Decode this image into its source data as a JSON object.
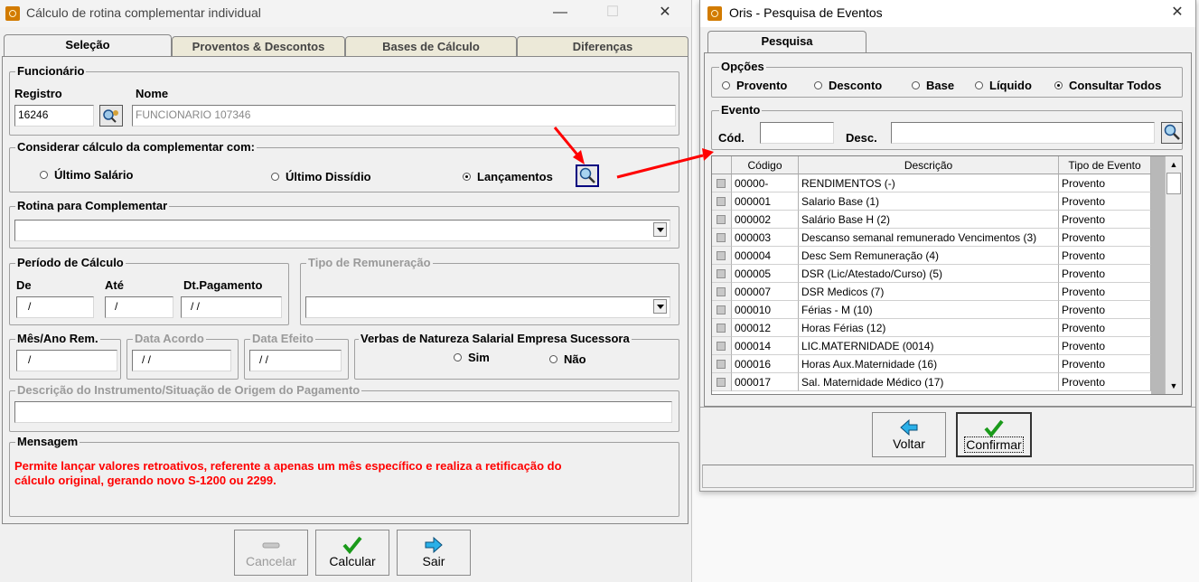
{
  "left": {
    "title": "Cálculo de rotina complementar individual",
    "tabs": [
      "Seleção",
      "Proventos & Descontos",
      "Bases de Cálculo",
      "Diferenças"
    ],
    "funcionario": {
      "legend": "Funcionário",
      "registro_label": "Registro",
      "registro_value": "16246",
      "nome_label": "Nome",
      "nome_value": "FUNCIONARIO 107346"
    },
    "considerar": {
      "legend": "Considerar cálculo da complementar com:",
      "opt1": "Último Salário",
      "opt2": "Último Dissídio",
      "opt3": "Lançamentos"
    },
    "rotina": {
      "legend": "Rotina para Complementar",
      "value": ""
    },
    "periodo": {
      "legend": "Período de Cálculo",
      "de_label": "De",
      "de_value": "/",
      "ate_label": "Até",
      "ate_value": "/",
      "dtpag_label": "Dt.Pagamento",
      "dtpag_value": "/ /"
    },
    "tipo_remuneracao": {
      "legend": "Tipo de Remuneração",
      "value": ""
    },
    "mes_ano": {
      "legend": "Mês/Ano Rem.",
      "value": "/"
    },
    "data_acordo": {
      "legend": "Data Acordo",
      "value": "/ /"
    },
    "data_efeito": {
      "legend": "Data Efeito",
      "value": "/ /"
    },
    "verbas": {
      "legend": "Verbas de Natureza Salarial Empresa Sucessora",
      "sim": "Sim",
      "nao": "Não"
    },
    "descricao": {
      "legend": "Descrição do Instrumento/Situação de Origem do Pagamento",
      "value": ""
    },
    "mensagem": {
      "legend": "Mensagem",
      "line1": "Permite lançar valores retroativos, referente a apenas um mês específico e realiza a retificação do",
      "line2": "cálculo original, gerando novo S-1200 ou 2299."
    },
    "buttons": {
      "cancelar": "Cancelar",
      "calcular": "Calcular",
      "sair": "Sair"
    }
  },
  "right": {
    "title": "Oris - Pesquisa de Eventos",
    "tab": "Pesquisa",
    "opcoes": {
      "legend": "Opções",
      "provento": "Provento",
      "desconto": "Desconto",
      "base": "Base",
      "liquido": "Líquido",
      "consultar": "Consultar Todos"
    },
    "evento": {
      "legend": "Evento",
      "cod_label": "Cód.",
      "cod_value": "",
      "desc_label": "Desc.",
      "desc_value": ""
    },
    "grid": {
      "headers": [
        "Código",
        "Descrição",
        "Tipo de Evento"
      ],
      "rows": [
        [
          "00000-",
          "RENDIMENTOS (-)",
          "Provento"
        ],
        [
          "000001",
          "Salario Base (1)",
          "Provento"
        ],
        [
          "000002",
          "Salário Base H (2)",
          "Provento"
        ],
        [
          "000003",
          "Descanso semanal remunerado Vencimentos (3)",
          "Provento"
        ],
        [
          "000004",
          "Desc Sem Remuneração (4)",
          "Provento"
        ],
        [
          "000005",
          "DSR (Lic/Atestado/Curso) (5)",
          "Provento"
        ],
        [
          "000007",
          "DSR Medicos (7)",
          "Provento"
        ],
        [
          "000010",
          "Férias - M (10)",
          "Provento"
        ],
        [
          "000012",
          "Horas Férias (12)",
          "Provento"
        ],
        [
          "000014",
          "LIC.MATERNIDADE (0014)",
          "Provento"
        ],
        [
          "000016",
          "Horas Aux.Maternidade (16)",
          "Provento"
        ],
        [
          "000017",
          "Sal. Maternidade Médico (17)",
          "Provento"
        ]
      ]
    },
    "buttons": {
      "voltar": "Voltar",
      "confirmar": "Confirmar"
    }
  },
  "colors": {
    "annotation_arrow": "#ff0000",
    "message_text": "#ff0000"
  }
}
